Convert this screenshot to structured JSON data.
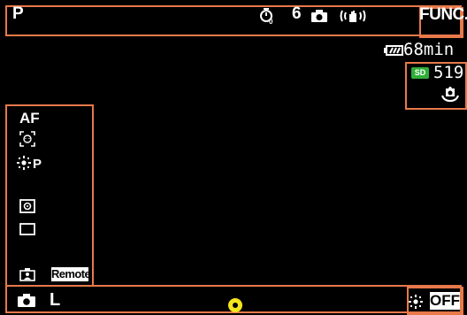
{
  "top_bar": {
    "mode": "P",
    "timer_icon": "self-timer-icon",
    "timer_value": "6",
    "drive_icon": "camera-icon",
    "stabilizer_icon": "image-stabilizer-icon",
    "func_label": "FUNC."
  },
  "status": {
    "battery_icon": "battery-icon",
    "battery_text": "68min",
    "card_badge": "SD",
    "shots_remaining": "519",
    "stabilizer_mode_icon": "dynamic-is-icon"
  },
  "left_panel": {
    "af_label": "AF",
    "face_icon": "face-detect-icon",
    "flash_icon": "flash-program-icon",
    "flash_label": "P",
    "metering_icon": "metering-icon",
    "frame_icon": "aspect-frame-icon",
    "person_icon": "person-icon",
    "remote_label": "Remote"
  },
  "bottom_bar": {
    "cam_icon": "camera-icon",
    "quality_label": "L",
    "center_icon": "focus-point-icon",
    "flash_off_icon": "flash-icon",
    "flash_off_label": "OFF"
  },
  "colors": {
    "frame_orange": "#e8794a",
    "sd_green": "#2fae3a",
    "focus_yellow": "#f4e51c"
  }
}
